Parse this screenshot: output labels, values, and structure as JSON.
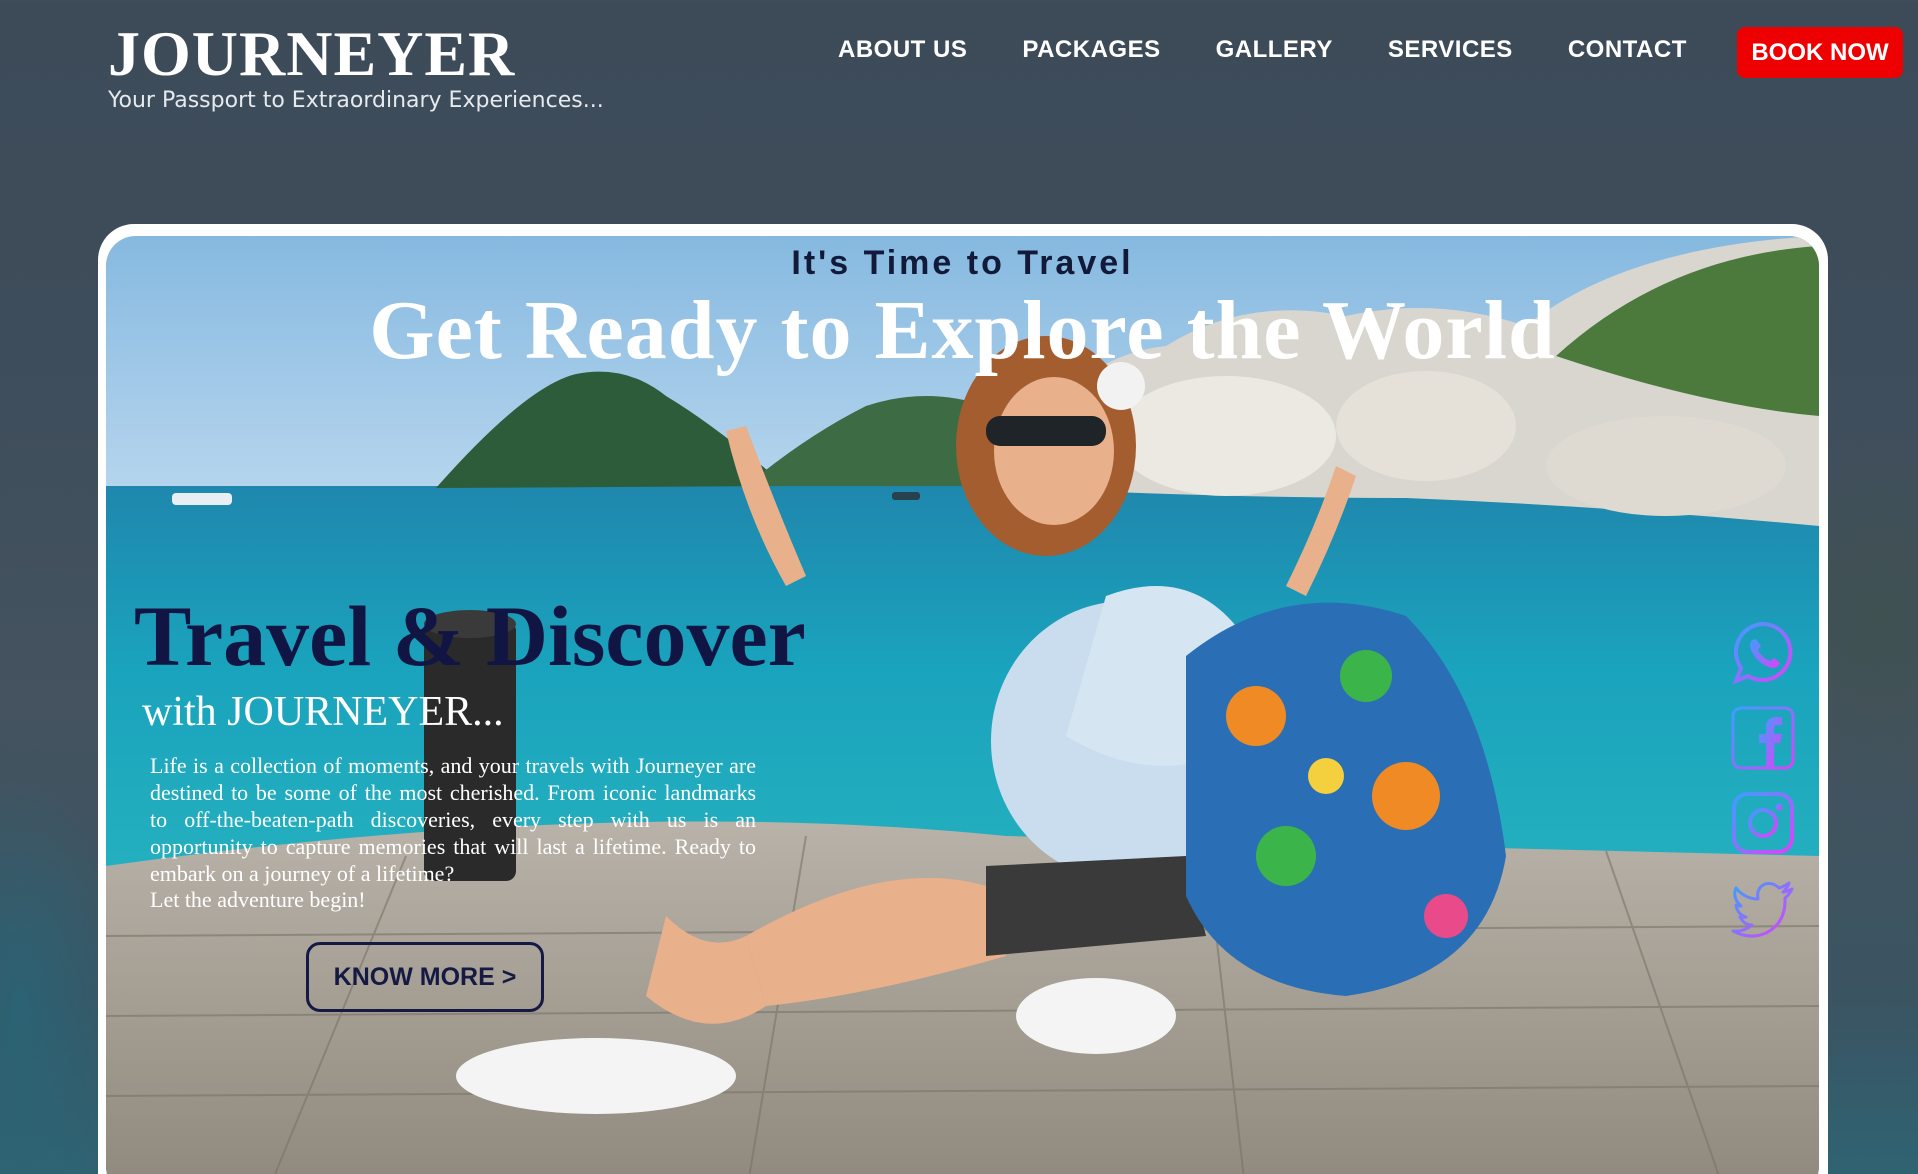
{
  "brand": {
    "title": "JOURNEYER",
    "tagline": "Your Passport to Extraordinary Experiences..."
  },
  "nav": {
    "items": [
      {
        "label": "ABOUT US"
      },
      {
        "label": "PACKAGES"
      },
      {
        "label": "GALLERY"
      },
      {
        "label": "SERVICES"
      },
      {
        "label": "CONTACT"
      }
    ],
    "cta_label": "BOOK NOW"
  },
  "hero": {
    "eyebrow": "It's Time to Travel",
    "headline": "Get Ready to Explore the World",
    "title": "Travel & Discover",
    "subtitle": "with JOURNEYER...",
    "body": "Life is a collection of moments, and your travels with Journeyer are destined to be some of the most cherished. From iconic landmarks to off-the-beaten-path discoveries, every step with us is an opportunity to capture memories that will last a lifetime. Ready to embark on a journey of a lifetime?",
    "body_last": "Let the adventure begin!",
    "button_label": "KNOW MORE >"
  },
  "social": {
    "icons": [
      "whatsapp-icon",
      "facebook-icon",
      "instagram-icon",
      "twitter-icon"
    ]
  },
  "colors": {
    "accent": "#ee0000",
    "dark_navy": "#111544",
    "header_bg": "#3d4b59",
    "social_gradient_start": "#3aa0ff",
    "social_gradient_end": "#e040fb"
  }
}
